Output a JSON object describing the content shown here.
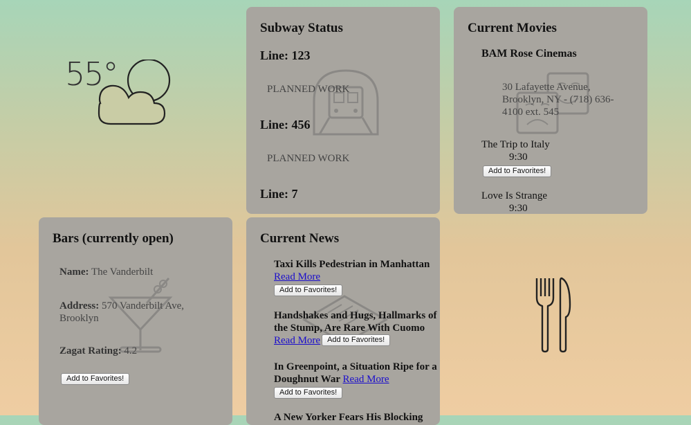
{
  "weather": {
    "temperature": "55°",
    "icon": "partly-cloudy-icon"
  },
  "subway": {
    "title": "Subway Status",
    "lines": [
      {
        "label": "Line: 123",
        "status": "PLANNED WORK"
      },
      {
        "label": "Line: 456",
        "status": "PLANNED WORK"
      },
      {
        "label": "Line: 7",
        "status": ""
      }
    ]
  },
  "movies": {
    "title": "Current Movies",
    "theater_name": "BAM Rose Cinemas",
    "theater_address": "30 Lafayette Avenue, Brooklyn, NY - (718) 636-4100 ext. 545",
    "films": [
      {
        "title": "The Trip to Italy",
        "time": "9:30",
        "button": "Add to Favorites!"
      },
      {
        "title": "Love Is Strange",
        "time": "9:30"
      }
    ]
  },
  "bars": {
    "title": "Bars (currently open)",
    "name_label": "Name:",
    "name_value": "The Vanderbilt",
    "address_label": "Address:",
    "address_value": "570 Vanderbilt Ave, Brooklyn",
    "zagat_label": "Zagat Rating:",
    "zagat_value": "4.2",
    "button": "Add to Favorites!"
  },
  "news": {
    "title": "Current News",
    "items": [
      {
        "headline": "Taxi Kills Pedestrian in Manhattan",
        "link": "Read More",
        "button": "Add to Favorites!"
      },
      {
        "headline": "Handshakes and Hugs, Hallmarks of the Stump, Are Rare With Cuomo",
        "link": "Read More",
        "button": "Add to Favorites!"
      },
      {
        "headline": "In Greenpoint, a Situation Ripe for a Doughnut War",
        "link": "Read More",
        "button": "Add to Favorites!"
      },
      {
        "headline": "A New Yorker Fears His Blocking",
        "link": "",
        "button": ""
      }
    ]
  },
  "restaurant": {
    "icon": "fork-knife-icon"
  }
}
